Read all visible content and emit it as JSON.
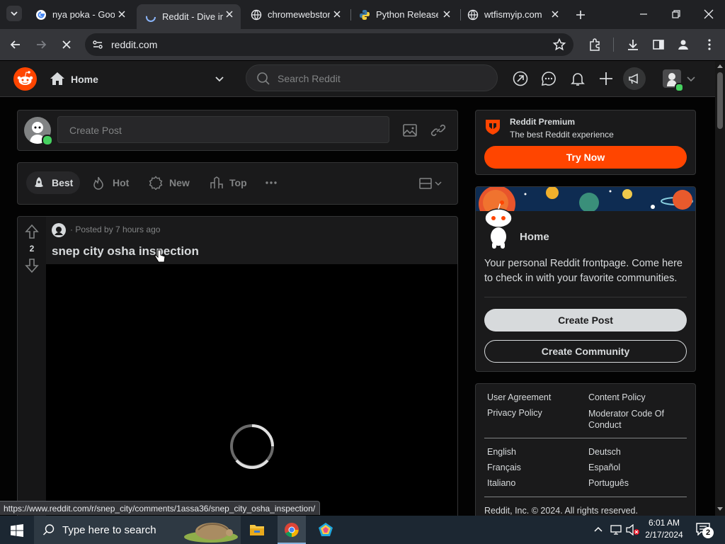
{
  "browser": {
    "tabs": [
      {
        "title": "nya poka - Goo",
        "active": false
      },
      {
        "title": "Reddit - Dive in",
        "active": true
      },
      {
        "title": "chromewebstor",
        "active": false
      },
      {
        "title": "Python Release",
        "active": false
      },
      {
        "title": "wtfismyip.com",
        "active": false
      }
    ],
    "address": "reddit.com",
    "status_url": "https://www.reddit.com/r/snep_city/comments/1assa36/snep_city_osha_inspection/"
  },
  "reddit": {
    "home_label": "Home",
    "search_placeholder": "Search Reddit",
    "create_post_placeholder": "Create Post",
    "sort": {
      "best": "Best",
      "hot": "Hot",
      "new": "New",
      "top": "Top"
    },
    "post": {
      "meta": "· Posted by 7 hours ago",
      "votes": "2",
      "title": "snep city osha inspection"
    },
    "premium": {
      "title": "Reddit Premium",
      "subtitle": "The best Reddit experience",
      "cta": "Try Now"
    },
    "home_card": {
      "title": "Home",
      "description": "Your personal Reddit frontpage. Come here to check in with your favorite communities.",
      "create_post": "Create Post",
      "create_community": "Create Community"
    },
    "footer": {
      "links_left": [
        "User Agreement",
        "Privacy Policy"
      ],
      "links_right": [
        "Content Policy",
        "Moderator Code Of Conduct"
      ],
      "langs_left": [
        "English",
        "Français",
        "Italiano"
      ],
      "langs_right": [
        "Deutsch",
        "Español",
        "Português"
      ],
      "copyright": "Reddit, Inc. © 2024. All rights reserved."
    }
  },
  "taskbar": {
    "search_placeholder": "Type here to search",
    "time": "6:01 AM",
    "date": "2/17/2024",
    "notifications": "2"
  },
  "colors": {
    "accent": "#ff4500",
    "online": "#46d160"
  }
}
